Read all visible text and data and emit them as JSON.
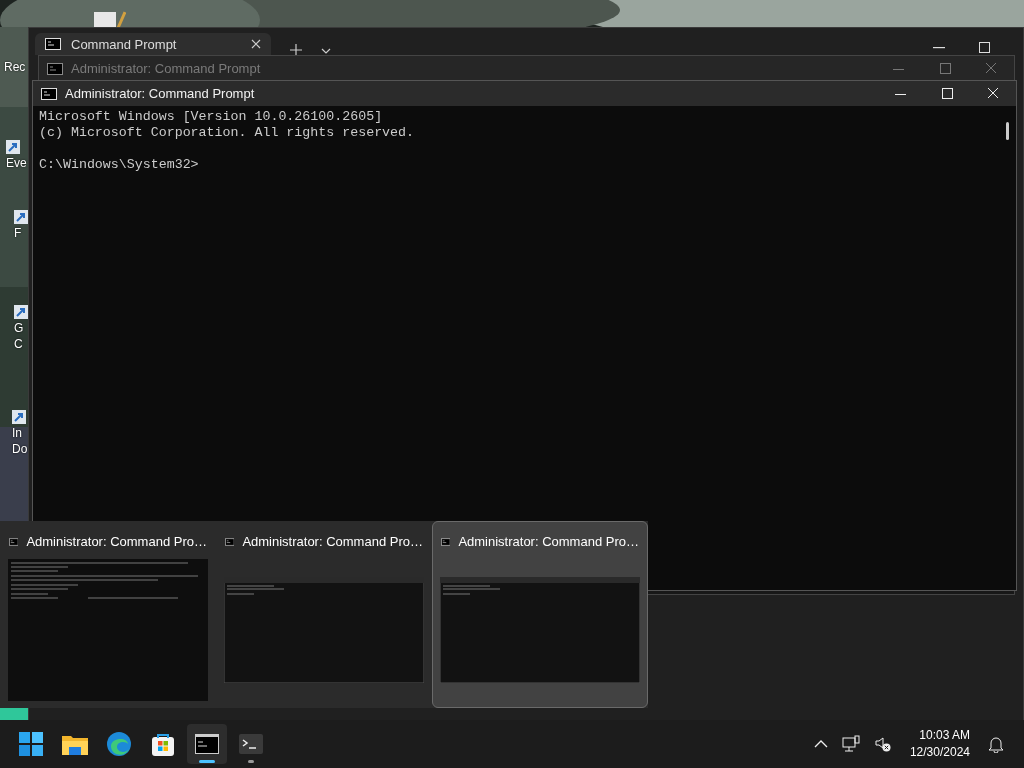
{
  "desktop": {
    "icons": [
      {
        "lines": [
          "Rec"
        ]
      },
      {
        "lines": [
          "Eve"
        ]
      },
      {
        "lines": [
          "F"
        ]
      },
      {
        "lines": [
          "G",
          "C"
        ]
      },
      {
        "lines": [
          "In",
          "Do"
        ]
      }
    ]
  },
  "terminal_window": {
    "tab": {
      "title": "Command Prompt",
      "selected": true
    }
  },
  "windows": [
    {
      "title": "Administrator: Command Prompt",
      "active": false
    },
    {
      "title": "Administrator: Command Prompt",
      "active": true
    }
  ],
  "console": {
    "blocks": [
      [
        "Microsoft Windows [Version 10.0.26100.2605]",
        "(c) Microsoft Corporation. All rights reserved."
      ],
      [
        "C:\\Windows\\System32>"
      ]
    ]
  },
  "thumbnails": [
    {
      "title": "Administrator: Command Pro…",
      "selected": false,
      "kind": "busy"
    },
    {
      "title": "Administrator: Command Pro…",
      "selected": false,
      "kind": "window"
    },
    {
      "title": "Administrator: Command Pro…",
      "selected": true,
      "kind": "window"
    }
  ],
  "taskbar": {
    "apps": [
      {
        "kind": "start",
        "open": false,
        "selected": false
      },
      {
        "kind": "explorer",
        "open": false,
        "selected": false
      },
      {
        "kind": "edge",
        "open": false,
        "selected": false
      },
      {
        "kind": "store",
        "open": false,
        "selected": false
      },
      {
        "kind": "cmd",
        "open": true,
        "selected": true
      },
      {
        "kind": "terminal",
        "open": true,
        "selected": false
      }
    ],
    "time": "10:03 AM",
    "date": "12/30/2024"
  }
}
